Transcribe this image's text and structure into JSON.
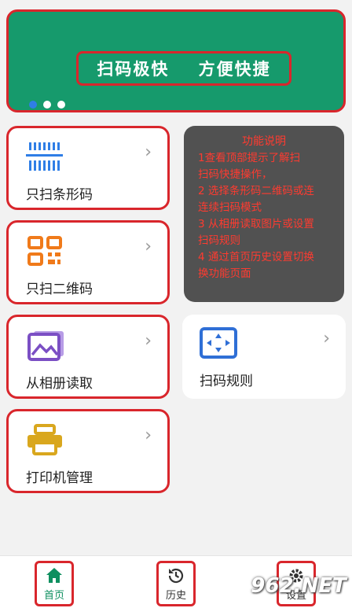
{
  "banner": {
    "text": "扫码极快    方便快捷",
    "dot_count": 3,
    "active_dot": 0
  },
  "cards": [
    {
      "id": "barcode",
      "label": "只扫条形码",
      "icon": "barcode-icon",
      "color": "#2f7ee6"
    },
    {
      "id": "qrcode",
      "label": "只扫二维码",
      "icon": "qrcode-icon",
      "color": "#f07a1a"
    },
    {
      "id": "album",
      "label": "从相册读取",
      "icon": "photo-album-icon",
      "color": "#7b4fc4"
    },
    {
      "id": "rules",
      "label": "扫码规则",
      "icon": "scan-frame-icon",
      "color": "#2f6fd6"
    },
    {
      "id": "printer",
      "label": "打印机管理",
      "icon": "printer-icon",
      "color": "#d9a71e"
    }
  ],
  "overlay": {
    "title": "功能说明",
    "lines": [
      "1查看顶部提示了解扫",
      "扫码快捷操作，",
      "2 选择条形码二维码或连",
      "连续扫码模式",
      "3 从相册读取图片或设置",
      "扫码规则",
      "4 通过首页历史设置切换",
      "换功能页面"
    ]
  },
  "nav": {
    "home_label": "首页",
    "history_label": "历史",
    "settings_label": "设置"
  },
  "watermark": "962.NET",
  "colors": {
    "brand_green": "#169a6c",
    "highlight_red": "#d9262c",
    "overlay_text": "#ff3b30"
  }
}
